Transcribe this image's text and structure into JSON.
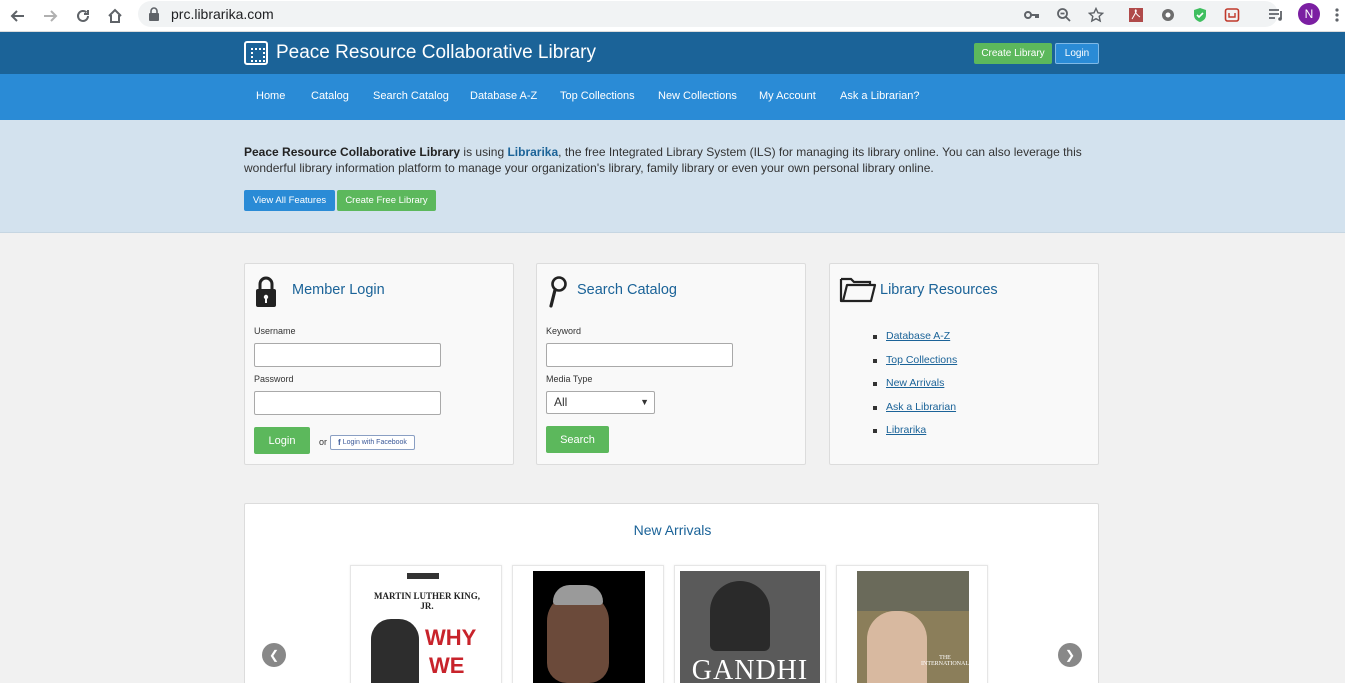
{
  "browser": {
    "url": "prc.librarika.com",
    "avatar_initial": "N",
    "icons": [
      "back-icon",
      "forward-icon",
      "reload-icon",
      "home-icon",
      "lock-icon",
      "key-icon",
      "zoom-icon",
      "star-icon",
      "pdf-extension-icon",
      "extension-icon",
      "shield-extension-icon",
      "extension-icon",
      "playlist-icon",
      "menu-icon"
    ]
  },
  "header": {
    "title": "Peace Resource Collaborative Library",
    "create_library": "Create Library",
    "login": "Login"
  },
  "nav": {
    "items": [
      "Home",
      "Catalog",
      "Search Catalog",
      "Database A-Z",
      "Top Collections",
      "New Collections",
      "My Account",
      "Ask a Librarian?"
    ]
  },
  "promo": {
    "library_name": "Peace Resource Collaborative Library",
    "text_1": " is using ",
    "brand": "Librarika",
    "text_2": ", the free Integrated Library System (ILS) for managing its library online. You can also leverage this wonderful library information platform to manage your organization's library, family library or even your own personal library online.",
    "view_features": "View All Features",
    "create_free": "Create Free Library"
  },
  "member_login": {
    "title": "Member Login",
    "username_label": "Username",
    "password_label": "Password",
    "login_button": "Login",
    "or": "or",
    "facebook_button": "Login with Facebook"
  },
  "search_catalog": {
    "title": "Search Catalog",
    "keyword_label": "Keyword",
    "media_type_label": "Media Type",
    "media_type_value": "All",
    "search_button": "Search"
  },
  "resources": {
    "title": "Library Resources",
    "links": [
      "Database A-Z",
      "Top Collections",
      "New Arrivals",
      "Ask a Librarian",
      "Librarika"
    ]
  },
  "arrivals": {
    "title": "New Arrivals",
    "books": [
      {
        "cover_text_1": "MARTIN LUTHER KING, JR.",
        "cover_text_2": "WHY",
        "cover_text_3": "WE"
      },
      {},
      {
        "cover_text_1": "GANDHI"
      },
      {
        "cover_text_1": "THE INTERNATIONAL"
      }
    ]
  },
  "colors": {
    "header_bg": "#1b6398",
    "nav_bg": "#2a8bd6",
    "promo_bg": "#d3e2ee",
    "green": "#5cb85c"
  }
}
